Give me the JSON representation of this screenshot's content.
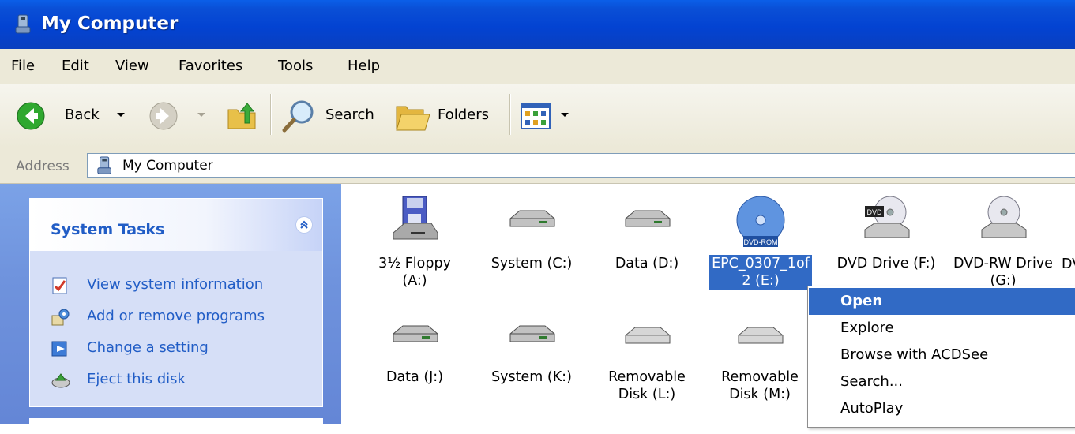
{
  "window": {
    "title": "My Computer"
  },
  "menu": [
    "File",
    "Edit",
    "View",
    "Favorites",
    "Tools",
    "Help"
  ],
  "toolbar": {
    "back_label": "Back",
    "search_label": "Search",
    "folders_label": "Folders"
  },
  "address": {
    "label": "Address",
    "value": "My Computer"
  },
  "system_tasks": {
    "title": "System Tasks",
    "items": [
      {
        "label": "View system information",
        "icon": "system-info-icon"
      },
      {
        "label": "Add or remove programs",
        "icon": "add-remove-programs-icon"
      },
      {
        "label": "Change a setting",
        "icon": "control-panel-icon"
      },
      {
        "label": "Eject this disk",
        "icon": "eject-disk-icon"
      }
    ]
  },
  "drives": [
    {
      "label": "3½ Floppy\n(A:)",
      "icon": "floppy-drive-icon"
    },
    {
      "label": "System (C:)",
      "icon": "hard-disk-icon"
    },
    {
      "label": "Data (D:)",
      "icon": "hard-disk-icon"
    },
    {
      "label": "EPC_0307_1of\n2 (E:)",
      "icon": "dvd-rom-disc-icon",
      "selected": true,
      "disc_text": "DVD-ROM"
    },
    {
      "label": "DVD Drive (F:)",
      "icon": "dvd-drive-icon",
      "disc_text": "DVD"
    },
    {
      "label": "DVD-RW Drive\n(G:)",
      "icon": "dvd-rw-drive-icon"
    },
    {
      "label": "DV",
      "icon": "drive-icon-partial"
    },
    {
      "label": "Data (J:)",
      "icon": "hard-disk-icon"
    },
    {
      "label": "System (K:)",
      "icon": "hard-disk-icon"
    },
    {
      "label": "Removable\nDisk (L:)",
      "icon": "removable-disk-icon"
    },
    {
      "label": "Removable\nDisk (M:)",
      "icon": "removable-disk-icon"
    }
  ],
  "context_menu": {
    "items": [
      {
        "label": "Open",
        "highlighted": true
      },
      {
        "label": "Explore"
      },
      {
        "label": "Browse with ACDSee"
      },
      {
        "label": "Search..."
      },
      {
        "label": "AutoPlay"
      }
    ]
  },
  "colors": {
    "titlebar": "#0343d2",
    "selection": "#316ac5",
    "task_link": "#215dc6",
    "task_pane": "#6f93dd"
  }
}
